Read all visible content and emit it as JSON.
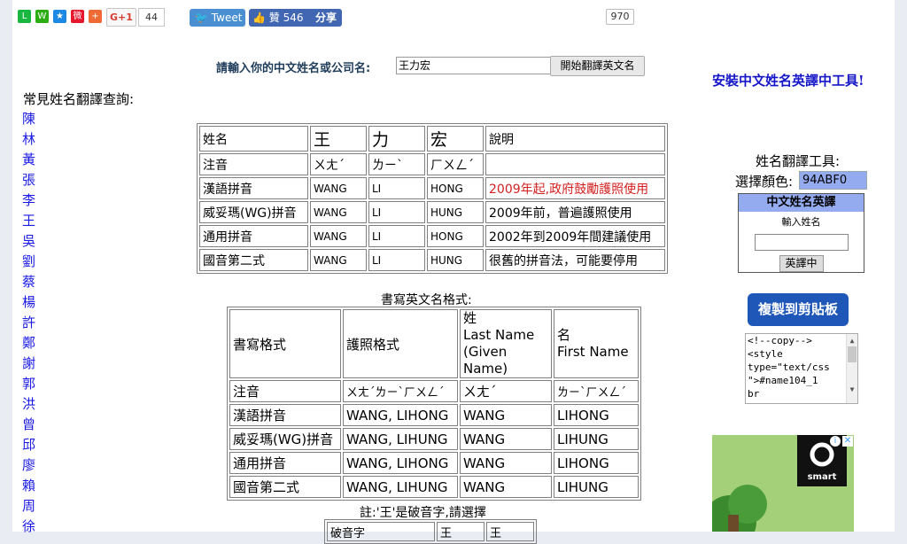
{
  "share_bar": {
    "gplus_label": "G+1",
    "gplus_count": "44",
    "tweet_label": "Tweet",
    "like_label": "贊 546",
    "share_label": "分享",
    "share_count": "970"
  },
  "form": {
    "label": "請輸入你的中文姓名或公司名:",
    "name_value": "王力宏",
    "submit_label": "開始翻譯英文名"
  },
  "install_link": "安裝中文姓名英譯中工具!",
  "common_names": {
    "title": "常見姓名翻譯查詢:",
    "items": [
      "陳",
      "林",
      "黃",
      "張",
      "李",
      "王",
      "吳",
      "劉",
      "蔡",
      "楊",
      "許",
      "鄭",
      "謝",
      "郭",
      "洪",
      "曾",
      "邱",
      "廖",
      "賴",
      "周",
      "徐"
    ]
  },
  "table1": {
    "header": [
      "姓名",
      "王",
      "力",
      "宏",
      "說明"
    ],
    "rows": [
      [
        "注音",
        "ㄨㄤˊ",
        "ㄌㄧˋ",
        "ㄏㄨㄥˊ",
        ""
      ],
      [
        "漢語拼音",
        "WANG",
        "LI",
        "HONG",
        "2009年起,政府鼓勵護照使用"
      ],
      [
        "威妥瑪(WG)拼音",
        "WANG",
        "LI",
        "HUNG",
        "2009年前，普遍護照使用"
      ],
      [
        "通用拼音",
        "WANG",
        "LI",
        "HONG",
        "2002年到2009年間建議使用"
      ],
      [
        "國音第二式",
        "WANG",
        "LI",
        "HUNG",
        "很舊的拼音法，可能要停用"
      ]
    ]
  },
  "table2": {
    "title": "書寫英文名格式:",
    "header": [
      "書寫格式",
      "護照格式",
      "姓\nLast Name\n(Given Name)",
      "名\nFirst Name"
    ],
    "rows": [
      [
        "注音",
        "ㄨㄤˊㄌㄧˋㄏㄨㄥˊ",
        "ㄨㄤˊ",
        "ㄌㄧˋㄏㄨㄥˊ"
      ],
      [
        "漢語拼音",
        "WANG, LIHONG",
        "WANG",
        "LIHONG"
      ],
      [
        "威妥瑪(WG)拼音",
        "WANG, LIHUNG",
        "WANG",
        "LIHUNG"
      ],
      [
        "通用拼音",
        "WANG, LIHONG",
        "WANG",
        "LIHONG"
      ],
      [
        "國音第二式",
        "WANG, LIHUNG",
        "WANG",
        "LIHUNG"
      ]
    ]
  },
  "note": {
    "text": "註:'王'是破音字,請選擇",
    "header": [
      "破音字",
      "王",
      "王"
    ]
  },
  "tool": {
    "title": "姓名翻譯工具:",
    "color_label": "選擇顏色:",
    "color_value": "94ABF0",
    "widget_title": "中文姓名英譯",
    "widget_input_label": "輸入姓名",
    "widget_button": "英譯中",
    "copy_button": "複製到剪貼板",
    "code_lines": [
      "<!--copy-->",
      "<style",
      "type=\"text/css",
      "\">#name104_1",
      "br"
    ]
  },
  "ad": {
    "brand": "smart"
  }
}
